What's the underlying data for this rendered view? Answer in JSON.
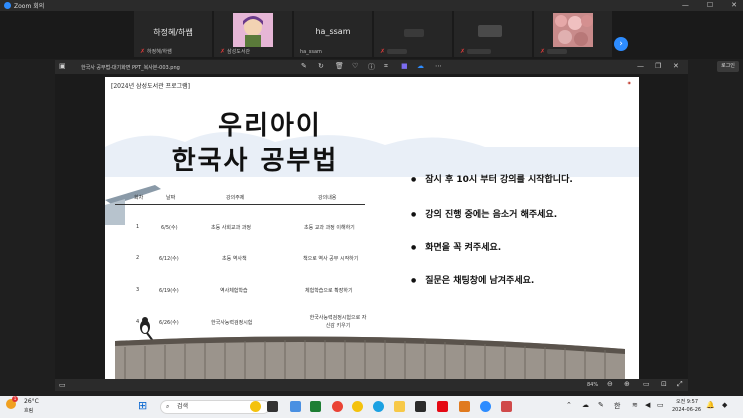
{
  "app": {
    "title": "Zoom 회의"
  },
  "gallery": {
    "tiles": [
      {
        "big_name": "하정혜/하쌤",
        "small_name": "하정혜/하쌤"
      },
      {
        "big_name": "",
        "small_name": "삼성도서관"
      },
      {
        "big_name": "ha_ssam",
        "small_name": "ha_ssam"
      },
      {
        "big_name": "",
        "small_name": ""
      },
      {
        "big_name": "",
        "small_name": ""
      },
      {
        "big_name": "",
        "small_name": ""
      }
    ]
  },
  "share": {
    "filename": "한국사 공부법-대기화면 PPT_복사본-003.png",
    "record_label": "로그인"
  },
  "slide": {
    "program": "[2024년 삼성도서관 프로그램]",
    "title_line1": "우리아이",
    "title_line2": "한국사 공부법",
    "table": {
      "headers": [
        "회차",
        "날짜",
        "강의주제",
        "강의내용"
      ],
      "rows": [
        [
          "1",
          "6/5(수)",
          "초등 사회교과 과정",
          "초등 교과 과정 이해하기"
        ],
        [
          "2",
          "6/12(수)",
          "초등 역사책",
          "책으로 역사 공부 시작하기"
        ],
        [
          "3",
          "6/19(수)",
          "역사체험학습",
          "체험학습으로 확장하기"
        ],
        [
          "4",
          "6/26(수)",
          "한국사능력검정시험",
          "한국사능력검정시험으로 자신감 키우기"
        ]
      ]
    },
    "bullets": [
      "잠시 후 10시 부터 강의를 시작합니다.",
      "강의 진행 중에는 음소거 해주세요.",
      "화면을 꼭 켜주세요.",
      "질문은 채팅창에 남겨주세요."
    ]
  },
  "zoombar": {
    "zoom_level": "84%"
  },
  "taskbar": {
    "weather_temp": "26°C",
    "weather_desc": "흐림",
    "search_placeholder": "검색",
    "ime": "한",
    "time": "오전 9:57",
    "date": "2024-06-26"
  }
}
